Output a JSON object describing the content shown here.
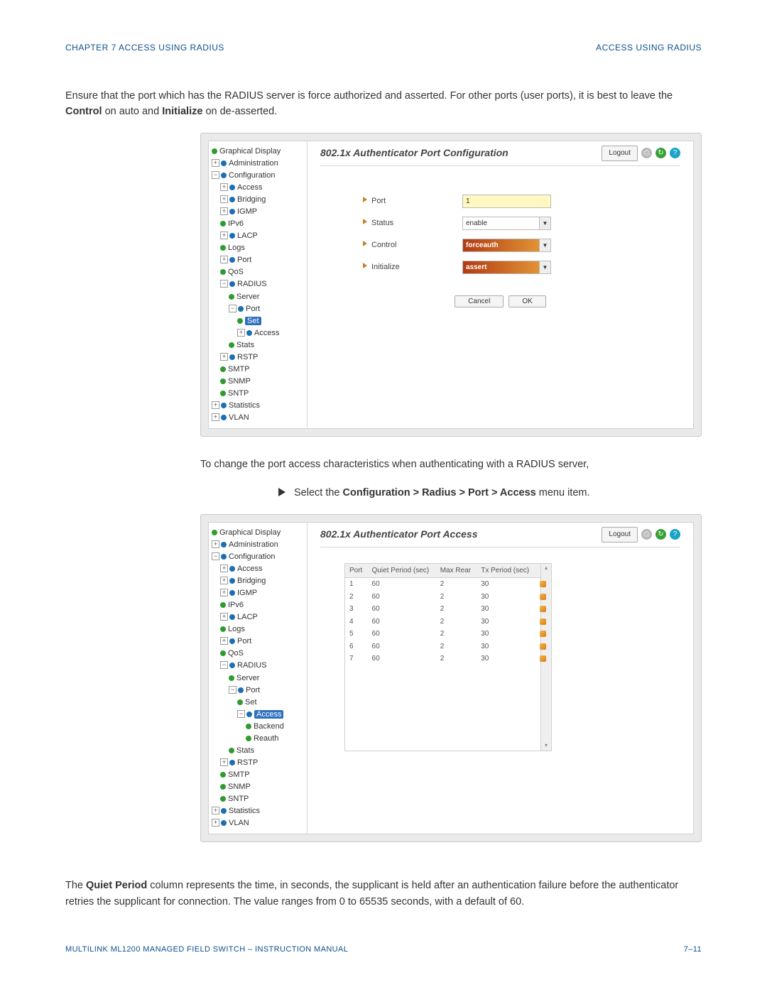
{
  "header": {
    "left": "CHAPTER 7  ACCESS USING RADIUS",
    "right": "ACCESS USING RADIUS"
  },
  "paragraphs": {
    "p1a": "Ensure that the port which has the RADIUS server is force authorized and asserted. For other ports (user ports), it is best to leave the ",
    "p1b": "Control",
    "p1c": " on auto and ",
    "p1d": "Initialize",
    "p1e": " on de-asserted.",
    "p2": "To change the port access characteristics when authenticating with a RADIUS server,",
    "step_a": "Select the ",
    "step_b": "Configuration > Radius > Port > Access",
    "step_c": " menu item.",
    "p3a": "The ",
    "p3b": "Quiet Period",
    "p3c": " column represents the time, in seconds, the supplicant is held after an authentication failure before the authenticator retries the supplicant for connection. The value ranges from 0 to 65535 seconds, with a default of 60."
  },
  "app": {
    "logout": "Logout",
    "tree": {
      "graphical": "Graphical Display",
      "admin": "Administration",
      "config": "Configuration",
      "access": "Access",
      "bridging": "Bridging",
      "igmp": "IGMP",
      "ipv6": "IPv6",
      "lacp": "LACP",
      "logs": "Logs",
      "port": "Port",
      "qos": "QoS",
      "radius": "RADIUS",
      "server": "Server",
      "rport": "Port",
      "set": "Set",
      "raccess": "Access",
      "backend": "Backend",
      "reauth": "Reauth",
      "stats": "Stats",
      "rstp": "RSTP",
      "smtp": "SMTP",
      "snmp": "SNMP",
      "sntp": "SNTP",
      "statistics": "Statistics",
      "vlan": "VLAN"
    },
    "shot1": {
      "title": "802.1x Authenticator Port Configuration",
      "form": {
        "port_lbl": "Port",
        "port_val": "1",
        "status_lbl": "Status",
        "status_val": "enable",
        "control_lbl": "Control",
        "control_val": "forceauth",
        "init_lbl": "Initialize",
        "init_val": "assert"
      },
      "cancel": "Cancel",
      "ok": "OK"
    },
    "shot2": {
      "title": "802.1x Authenticator Port Access",
      "cols": {
        "c1": "Port",
        "c2": "Quiet Period (sec)",
        "c3": "Max Rear",
        "c4": "Tx Period (sec)"
      },
      "rows": [
        {
          "p": "1",
          "q": "60",
          "m": "2",
          "t": "30"
        },
        {
          "p": "2",
          "q": "60",
          "m": "2",
          "t": "30"
        },
        {
          "p": "3",
          "q": "60",
          "m": "2",
          "t": "30"
        },
        {
          "p": "4",
          "q": "60",
          "m": "2",
          "t": "30"
        },
        {
          "p": "5",
          "q": "60",
          "m": "2",
          "t": "30"
        },
        {
          "p": "6",
          "q": "60",
          "m": "2",
          "t": "30"
        },
        {
          "p": "7",
          "q": "60",
          "m": "2",
          "t": "30"
        }
      ]
    }
  },
  "footer": {
    "left": "MULTILINK ML1200 MANAGED FIELD SWITCH – INSTRUCTION MANUAL",
    "right": "7–11"
  }
}
